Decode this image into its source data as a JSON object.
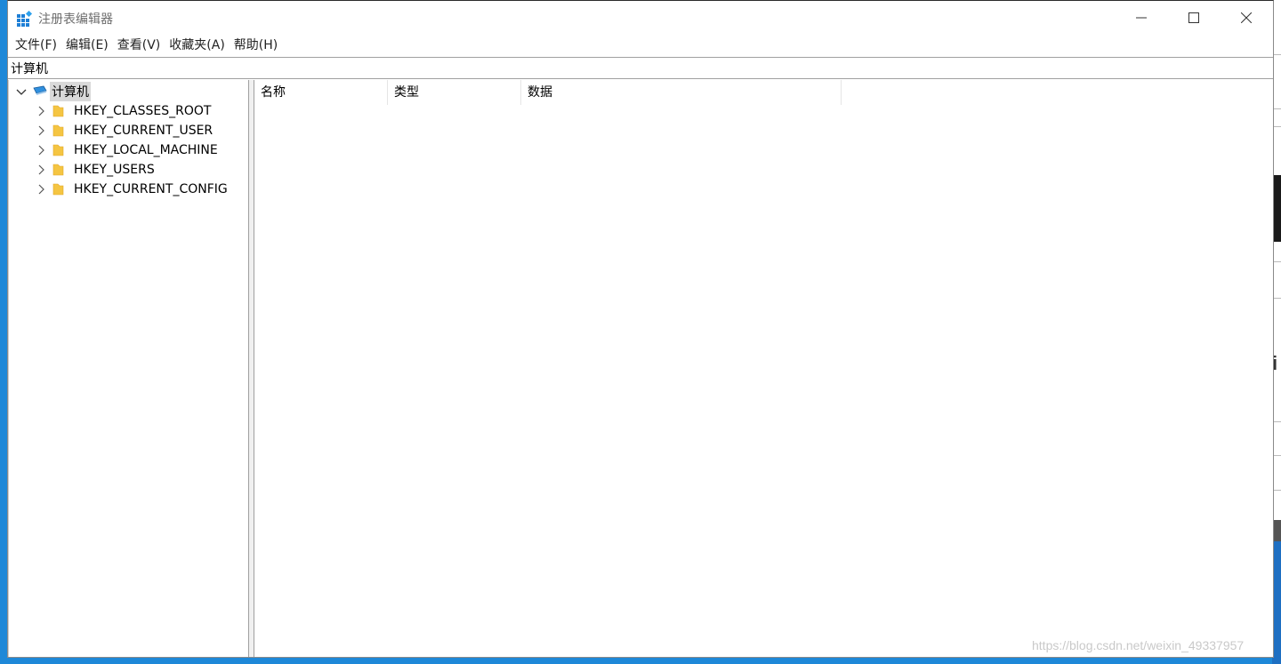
{
  "window": {
    "title": "注册表编辑器"
  },
  "menu": [
    "文件(F)",
    "编辑(E)",
    "查看(V)",
    "收藏夹(A)",
    "帮助(H)"
  ],
  "address": {
    "value": "计算机"
  },
  "tree": {
    "root": {
      "label": "计算机",
      "expanded": true,
      "selected": true
    },
    "children": [
      {
        "label": "HKEY_CLASSES_ROOT"
      },
      {
        "label": "HKEY_CURRENT_USER"
      },
      {
        "label": "HKEY_LOCAL_MACHINE"
      },
      {
        "label": "HKEY_USERS"
      },
      {
        "label": "HKEY_CURRENT_CONFIG"
      }
    ]
  },
  "list": {
    "columns": [
      "名称",
      "类型",
      "数据"
    ]
  },
  "watermark": "https://blog.csdn.net/weixin_49337957",
  "colors": {
    "desktop": "#1e88d8",
    "folder": "#f5c542",
    "selection": "#d9d9d9"
  },
  "icons": {
    "app": "regedit-icon",
    "computer": "computer-icon",
    "folder": "folder-icon"
  }
}
